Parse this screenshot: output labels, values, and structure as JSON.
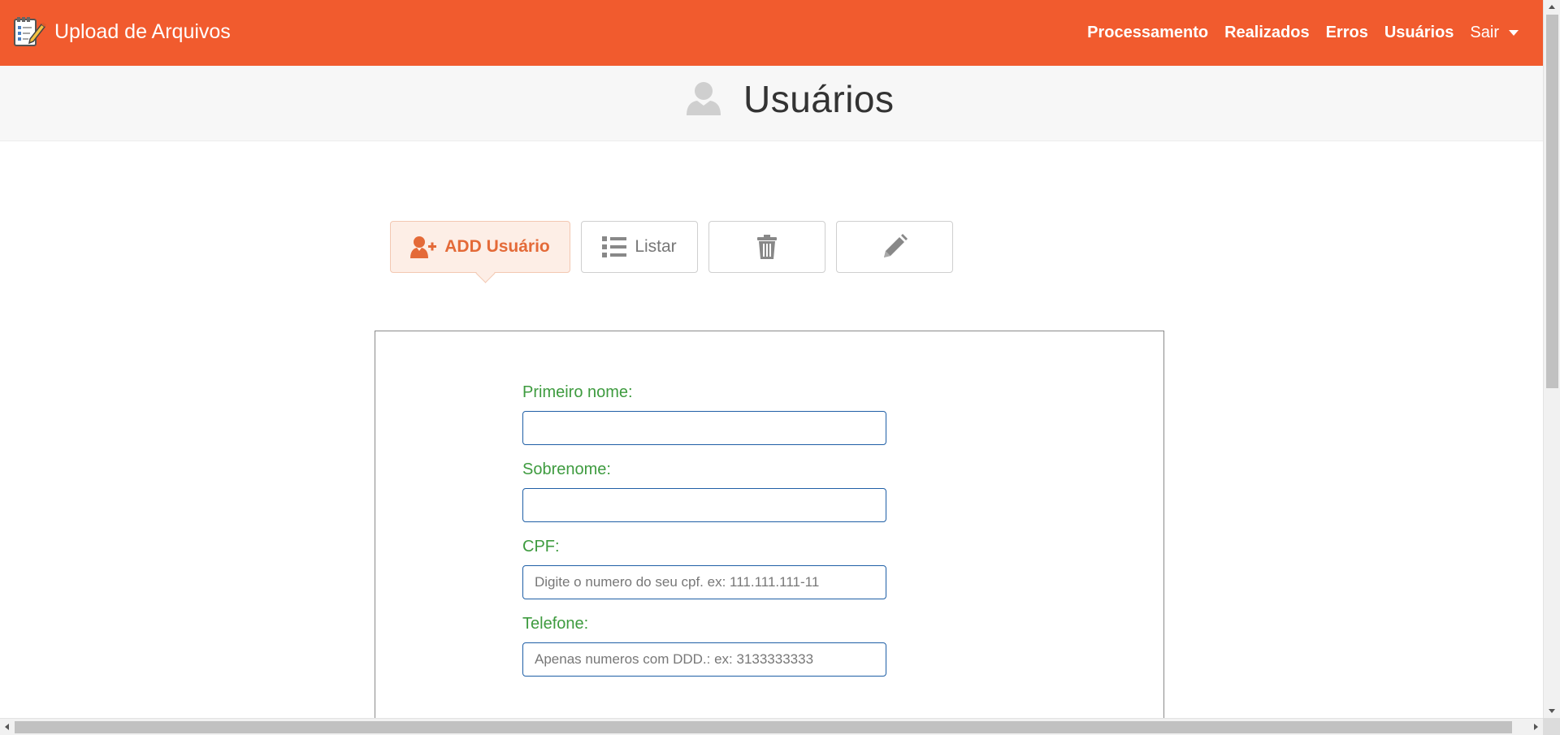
{
  "app": {
    "title": "Upload de Arquivos"
  },
  "nav": {
    "links": [
      "Processamento",
      "Realizados",
      "Erros",
      "Usuários"
    ],
    "dropdown_label": "Sair"
  },
  "page": {
    "title": "Usuários"
  },
  "actions": {
    "add_label": "ADD Usuário",
    "list_label": "Listar",
    "delete_icon": "trash-icon",
    "edit_icon": "pencil-icon"
  },
  "form": {
    "fields": [
      {
        "label": "Primeiro nome:",
        "value": "",
        "placeholder": ""
      },
      {
        "label": "Sobrenome:",
        "value": "",
        "placeholder": ""
      },
      {
        "label": "CPF:",
        "value": "",
        "placeholder": "Digite o numero do seu cpf. ex: 111.111.111-11"
      },
      {
        "label": "Telefone:",
        "value": "",
        "placeholder": "Apenas numeros com DDD.: ex: 3133333333"
      }
    ]
  },
  "colors": {
    "navbar": "#f15b2e",
    "label_green": "#3e9b3f",
    "active_button_bg": "#fdeee6",
    "active_button_text": "#e46a38",
    "input_border": "#1f5fa6"
  }
}
